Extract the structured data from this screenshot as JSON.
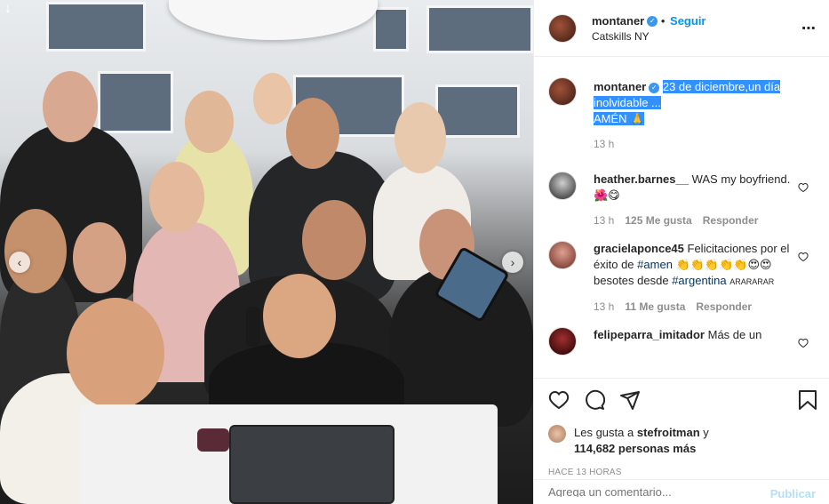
{
  "post": {
    "author": "montaner",
    "follow_label": "Seguir",
    "location": "Catskills NY",
    "more_icon": "⋯",
    "verified_icon": "✓"
  },
  "caption": {
    "username": "montaner",
    "text_line1": "23 de diciembre,un día",
    "text_line2": "inolvidable ...",
    "text_line3": "AMÉN 🙏",
    "time": "13 h"
  },
  "comments": [
    {
      "username": "heather.barnes__",
      "text": "WAS my boyfriend. 🌺😋",
      "time": "13 h",
      "likes": "125 Me gusta",
      "reply": "Responder"
    },
    {
      "username": "gracielaponce45",
      "text_before": "Felicitaciones por el éxito de",
      "hashtag1": "#amen",
      "text_middle": "👏👏👏👏👏😍😍besotes desde",
      "hashtag2": "#argentina",
      "text_after": "ARARARAR",
      "time": "13 h",
      "likes": "11 Me gusta",
      "reply": "Responder"
    },
    {
      "username": "felipeparra_imitador",
      "text": "Más de un"
    }
  ],
  "likes": {
    "prefix": "Les gusta a",
    "user": "stefroitman",
    "conjunction": "y",
    "count": "114,682 personas más"
  },
  "time_ago": "HACE 13 HORAS",
  "add_comment": {
    "placeholder": "Agrega un comentario...",
    "publish_label": "Publicar"
  },
  "photo": {
    "prev_arrow": "‹",
    "next_arrow": "›",
    "download_arrow": "↓"
  }
}
